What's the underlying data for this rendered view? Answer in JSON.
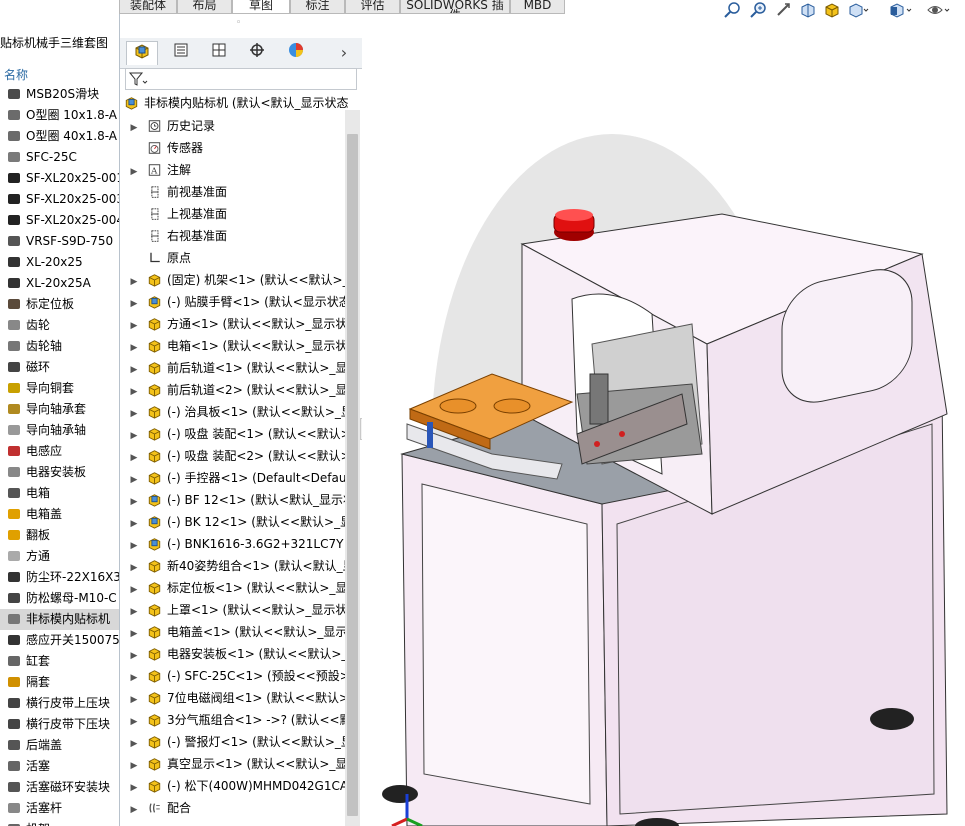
{
  "file_panel": {
    "title": "贴标机械手三维套图",
    "column_header": "名称",
    "items": [
      {
        "label": "MSB20S滑块",
        "icon": "part-icon",
        "color": "#4a4a4a"
      },
      {
        "label": "O型圈 10x1.8-A",
        "icon": "part-icon",
        "color": "#6b6b6b"
      },
      {
        "label": "O型圈 40x1.8-A",
        "icon": "part-icon",
        "color": "#6b6b6b"
      },
      {
        "label": "SFC-25C",
        "icon": "part-icon",
        "color": "#7a7a7a"
      },
      {
        "label": "SF-XL20x25-001",
        "icon": "part-icon",
        "color": "#222222"
      },
      {
        "label": "SF-XL20x25-003",
        "icon": "part-icon",
        "color": "#222222"
      },
      {
        "label": "SF-XL20x25-004",
        "icon": "part-icon",
        "color": "#222222"
      },
      {
        "label": "VRSF-S9D-750",
        "icon": "part-icon",
        "color": "#555555"
      },
      {
        "label": "XL-20x25",
        "icon": "part-icon",
        "color": "#333333"
      },
      {
        "label": "XL-20x25A",
        "icon": "part-icon",
        "color": "#333333"
      },
      {
        "label": "标定位板",
        "icon": "part-icon",
        "color": "#5a4a3a"
      },
      {
        "label": "齿轮",
        "icon": "part-icon",
        "color": "#888888"
      },
      {
        "label": "齿轮轴",
        "icon": "part-icon",
        "color": "#777777"
      },
      {
        "label": "磁环",
        "icon": "part-icon",
        "color": "#444444"
      },
      {
        "label": "导向铜套",
        "icon": "part-icon",
        "color": "#c8a000"
      },
      {
        "label": "导向轴承套",
        "icon": "part-icon",
        "color": "#b08a20"
      },
      {
        "label": "导向轴承轴",
        "icon": "part-icon",
        "color": "#999999"
      },
      {
        "label": "电感应",
        "icon": "part-icon",
        "color": "#c03030"
      },
      {
        "label": "电器安装板",
        "icon": "part-icon",
        "color": "#888888"
      },
      {
        "label": "电箱",
        "icon": "part-icon",
        "color": "#555555"
      },
      {
        "label": "电箱盖",
        "icon": "assembly-icon",
        "color": "#e0a000"
      },
      {
        "label": "翻板",
        "icon": "assembly-icon",
        "color": "#e0a000"
      },
      {
        "label": "方通",
        "icon": "part-icon",
        "color": "#aaaaaa"
      },
      {
        "label": "防尘环-22X16X3.",
        "icon": "part-icon",
        "color": "#333333"
      },
      {
        "label": "防松螺母-M10-C",
        "icon": "part-icon",
        "color": "#444444"
      },
      {
        "label": "非标模内贴标机",
        "icon": "assembly-icon",
        "color": "#777777",
        "selected": true
      },
      {
        "label": "感应开关150075",
        "icon": "part-icon",
        "color": "#333333"
      },
      {
        "label": "缸套",
        "icon": "part-icon",
        "color": "#666666"
      },
      {
        "label": "隔套",
        "icon": "part-icon",
        "color": "#d09000"
      },
      {
        "label": "横行皮带上压块",
        "icon": "part-icon",
        "color": "#444444"
      },
      {
        "label": "横行皮带下压块",
        "icon": "part-icon",
        "color": "#444444"
      },
      {
        "label": "后端盖",
        "icon": "part-icon",
        "color": "#555555"
      },
      {
        "label": "活塞",
        "icon": "part-icon",
        "color": "#666666"
      },
      {
        "label": "活塞磁环安装块",
        "icon": "part-icon",
        "color": "#555555"
      },
      {
        "label": "活塞杆",
        "icon": "part-icon",
        "color": "#888888"
      },
      {
        "label": "机架",
        "icon": "part-icon",
        "color": "#666666"
      }
    ]
  },
  "tabs": [
    {
      "label": "装配体",
      "active": false
    },
    {
      "label": "布局",
      "active": false
    },
    {
      "label": "草图",
      "active": true
    },
    {
      "label": "标注",
      "active": false
    },
    {
      "label": "评估",
      "active": false
    },
    {
      "label": "SOLIDWORKS 插件",
      "active": false
    },
    {
      "label": "MBD",
      "active": false
    }
  ],
  "feature_manager": {
    "panel_tabs": [
      "feature-manager-icon",
      "property-manager-icon",
      "configuration-manager-icon",
      "dimxpert-icon",
      "display-manager-icon"
    ],
    "more_glyph": "›",
    "root": "非标模内贴标机  (默认<默认_显示状态",
    "items": [
      {
        "label": "历史记录",
        "icon": "history-icon",
        "expand": true
      },
      {
        "label": "传感器",
        "icon": "sensor-icon",
        "expand": false
      },
      {
        "label": "注解",
        "icon": "annotation-icon",
        "expand": true
      },
      {
        "label": "前视基准面",
        "icon": "plane-icon",
        "expand": false
      },
      {
        "label": "上视基准面",
        "icon": "plane-icon",
        "expand": false
      },
      {
        "label": "右视基准面",
        "icon": "plane-icon",
        "expand": false
      },
      {
        "label": "原点",
        "icon": "origin-icon",
        "expand": false
      },
      {
        "label": "(固定) 机架<1> (默认<<默认>_",
        "icon": "assembly-icon",
        "expand": true
      },
      {
        "label": "(-) 贴膜手臂<1> (默认<显示状态",
        "icon": "assembly-blue-icon",
        "expand": true
      },
      {
        "label": "方通<1> (默认<<默认>_显示状",
        "icon": "assembly-icon",
        "expand": true
      },
      {
        "label": "电箱<1> (默认<<默认>_显示状",
        "icon": "assembly-icon",
        "expand": true
      },
      {
        "label": "前后轨道<1> (默认<<默认>_显",
        "icon": "assembly-icon",
        "expand": true
      },
      {
        "label": "前后轨道<2> (默认<<默认>_显",
        "icon": "assembly-icon",
        "expand": true
      },
      {
        "label": "(-) 治具板<1> (默认<<默认>_显",
        "icon": "assembly-icon",
        "expand": true
      },
      {
        "label": "(-) 吸盘 装配<1> (默认<<默认>",
        "icon": "assembly-icon",
        "expand": true
      },
      {
        "label": "(-) 吸盘 装配<2> (默认<<默认>",
        "icon": "assembly-icon",
        "expand": true
      },
      {
        "label": "(-) 手控器<1> (Default<Default",
        "icon": "assembly-icon",
        "expand": true
      },
      {
        "label": "(-) BF 12<1> (默认<默认_显示状",
        "icon": "assembly-blue-icon",
        "expand": true
      },
      {
        "label": "(-) BK 12<1> (默认<<默认>_显",
        "icon": "assembly-blue-icon",
        "expand": true
      },
      {
        "label": "(-) BNK1616-3.6G2+321LC7Y (",
        "icon": "assembly-blue-icon",
        "expand": true
      },
      {
        "label": "新40姿势组合<1> (默认<默认_显",
        "icon": "assembly-icon",
        "expand": true
      },
      {
        "label": "标定位板<1> (默认<<默认>_显",
        "icon": "assembly-icon",
        "expand": true
      },
      {
        "label": "上罩<1> (默认<<默认>_显示状",
        "icon": "assembly-icon",
        "expand": true
      },
      {
        "label": "电箱盖<1> (默认<<默认>_显示",
        "icon": "assembly-icon",
        "expand": true
      },
      {
        "label": "电器安装板<1> (默认<<默认>_",
        "icon": "assembly-icon",
        "expand": true
      },
      {
        "label": "(-) SFC-25C<1> (预設<<预設>_",
        "icon": "assembly-icon",
        "expand": true
      },
      {
        "label": "7位电磁阀组<1> (默认<<默认>_",
        "icon": "assembly-icon",
        "expand": true
      },
      {
        "label": "3分气瓶组合<1> ->? (默认<<默",
        "icon": "assembly-icon",
        "expand": true
      },
      {
        "label": "(-) 警报灯<1> (默认<<默认>_显",
        "icon": "assembly-icon",
        "expand": true
      },
      {
        "label": "真空显示<1> (默认<<默认>_显",
        "icon": "assembly-icon",
        "expand": true
      },
      {
        "label": "(-) 松下(400W)MHMD042G1CA",
        "icon": "assembly-icon",
        "expand": true
      },
      {
        "label": "配合",
        "icon": "mates-icon",
        "expand": true
      }
    ]
  },
  "toolbar": {
    "icons": [
      "zoom-fit-icon",
      "zoom-area-icon",
      "previous-view-icon",
      "section-view-icon",
      "dynamic-annotation-icon",
      "display-style-icon",
      "view-orientation-icon",
      "hide-show-icon"
    ]
  },
  "graphics": {
    "description_colors": {
      "frame": "#f4e4f2",
      "orange_plate": "#e8902a",
      "red_light": "#e01010",
      "base_plate": "#8a8f98"
    }
  }
}
